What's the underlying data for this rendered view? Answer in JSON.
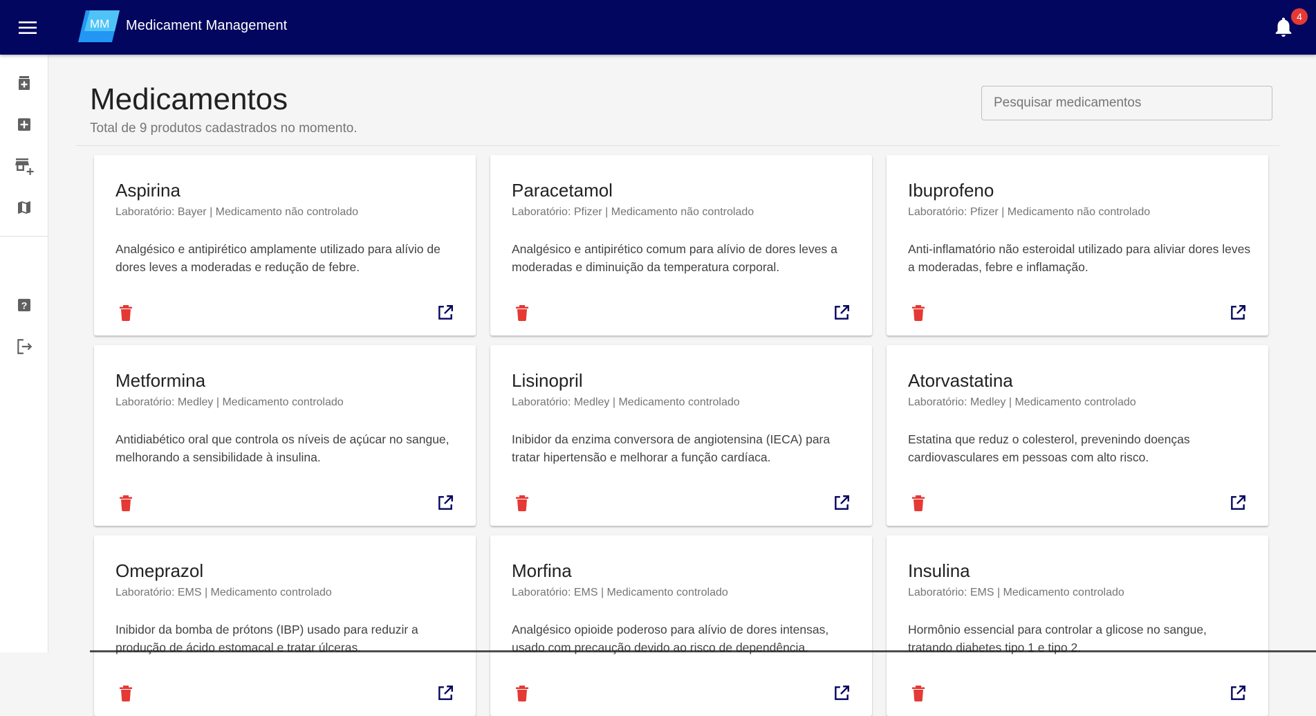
{
  "header": {
    "logo_text": "MM",
    "app_title": "Medicament Management",
    "notification_count": "4"
  },
  "sidebar": {
    "items": [
      {
        "icon": "medication-box-icon"
      },
      {
        "icon": "add-box-icon"
      },
      {
        "icon": "add-business-icon"
      },
      {
        "icon": "map-icon"
      },
      {
        "icon": "help-icon"
      },
      {
        "icon": "logout-icon"
      }
    ]
  },
  "page": {
    "title": "Medicamentos",
    "subtitle": "Total de 9 produtos cadastrados no momento.",
    "search_placeholder": "Pesquisar medicamentos"
  },
  "cards": [
    {
      "name": "Aspirina",
      "meta": "Laboratório: Bayer | Medicamento não controlado",
      "description": "Analgésico e antipirético amplamente utilizado para alívio de dores leves a moderadas e redução de febre."
    },
    {
      "name": "Paracetamol",
      "meta": "Laboratório: Pfizer | Medicamento não controlado",
      "description": "Analgésico e antipirético comum para alívio de dores leves a moderadas e diminuição da temperatura corporal."
    },
    {
      "name": "Ibuprofeno",
      "meta": "Laboratório: Pfizer | Medicamento não controlado",
      "description": "Anti-inflamatório não esteroidal utilizado para aliviar dores leves a moderadas, febre e inflamação."
    },
    {
      "name": "Metformina",
      "meta": "Laboratório: Medley | Medicamento controlado",
      "description": "Antidiabético oral que controla os níveis de açúcar no sangue, melhorando a sensibilidade à insulina."
    },
    {
      "name": "Lisinopril",
      "meta": "Laboratório: Medley | Medicamento controlado",
      "description": "Inibidor da enzima conversora de angiotensina (IECA) para tratar hipertensão e melhorar a função cardíaca."
    },
    {
      "name": "Atorvastatina",
      "meta": "Laboratório: Medley | Medicamento controlado",
      "description": "Estatina que reduz o colesterol, prevenindo doenças cardiovasculares em pessoas com alto risco."
    },
    {
      "name": "Omeprazol",
      "meta": "Laboratório: EMS | Medicamento controlado",
      "description": "Inibidor da bomba de prótons (IBP) usado para reduzir a produção de ácido estomacal e tratar úlceras."
    },
    {
      "name": "Morfina",
      "meta": "Laboratório: EMS | Medicamento controlado",
      "description": "Analgésico opioide poderoso para alívio de dores intensas, usado com precaução devido ao risco de dependência."
    },
    {
      "name": "Insulina",
      "meta": "Laboratório: EMS | Medicamento controlado",
      "description": "Hormônio essencial para controlar a glicose no sangue, tratando diabetes tipo 1 e tipo 2."
    }
  ],
  "colors": {
    "topbar": "#03065e",
    "delete": "#e53935",
    "open": "#03065e",
    "badge": "#e53935"
  }
}
